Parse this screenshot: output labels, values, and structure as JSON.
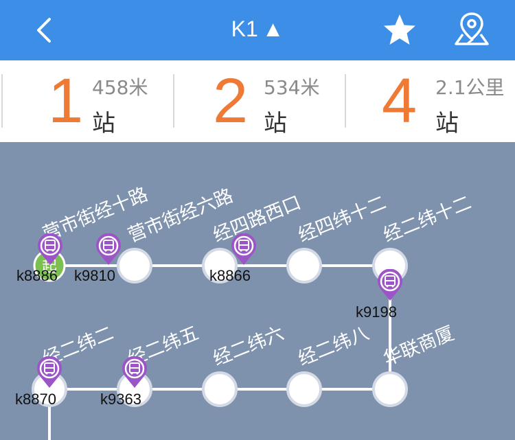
{
  "header": {
    "title": "K1",
    "title_arrow": "▲",
    "back_icon": "chevron-left-icon",
    "favorite_icon": "star-icon",
    "map_icon": "map-pin-icon",
    "background": "#3c8ee6"
  },
  "stats": [
    {
      "count": "1",
      "distance": "458米",
      "unit": "站"
    },
    {
      "count": "2",
      "distance": "534米",
      "unit": "站"
    },
    {
      "count": "4",
      "distance": "2.1公里",
      "unit": "站"
    }
  ],
  "colors": {
    "accent": "#ee7a35",
    "bus_pin": "#9b55c6",
    "start_marker": "#7cc052",
    "map_background": "#7f92ad"
  },
  "route": {
    "start_marker_text": "起",
    "stops": [
      {
        "name": "营市街经十路"
      },
      {
        "name": "营市街经六路"
      },
      {
        "name": "经四路西口"
      },
      {
        "name": "经四纬十二"
      },
      {
        "name": "经二纬十二"
      },
      {
        "name": "华联商厦"
      },
      {
        "name": "经二纬八"
      },
      {
        "name": "经二纬六"
      },
      {
        "name": "经二纬五"
      },
      {
        "name": "经二纬二"
      }
    ],
    "buses": [
      {
        "id": "k8886"
      },
      {
        "id": "k9810"
      },
      {
        "id": "k8866"
      },
      {
        "id": "k9198"
      },
      {
        "id": "k8870"
      },
      {
        "id": "k9363"
      }
    ]
  }
}
